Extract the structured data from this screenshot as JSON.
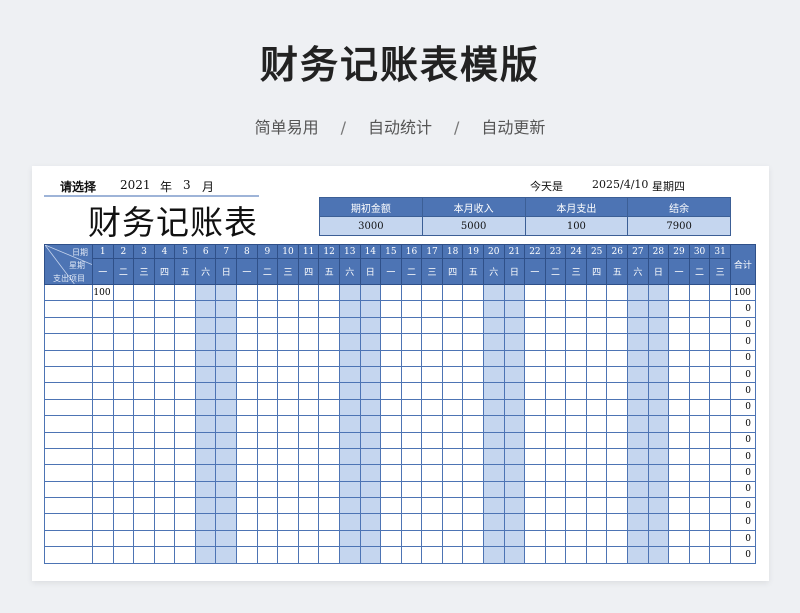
{
  "header": {
    "title": "财务记账表模版",
    "features": [
      "简单易用",
      "自动统计",
      "自动更新"
    ],
    "separator": "/"
  },
  "sheet": {
    "select_label": "请选择",
    "year": "2021",
    "year_unit": "年",
    "month": "3",
    "month_unit": "月",
    "today_label": "今天是",
    "today_date": "2025/4/10",
    "today_weekday": "星期四",
    "big_title": "财务记账表"
  },
  "summary": {
    "headers": [
      "期初金额",
      "本月收入",
      "本月支出",
      "结余"
    ],
    "values": [
      "3000",
      "5000",
      "100",
      "7900"
    ]
  },
  "grid": {
    "corner_date": "日期",
    "corner_week": "星期",
    "corner_item": "支出项目",
    "total_label": "合计",
    "days": [
      "1",
      "2",
      "3",
      "4",
      "5",
      "6",
      "7",
      "8",
      "9",
      "10",
      "11",
      "12",
      "13",
      "14",
      "15",
      "16",
      "17",
      "18",
      "19",
      "20",
      "21",
      "22",
      "23",
      "24",
      "25",
      "26",
      "27",
      "28",
      "29",
      "30",
      "31"
    ],
    "weekdays": [
      "一",
      "二",
      "三",
      "四",
      "五",
      "六",
      "日",
      "一",
      "二",
      "三",
      "四",
      "五",
      "六",
      "日",
      "一",
      "二",
      "三",
      "四",
      "五",
      "六",
      "日",
      "一",
      "二",
      "三",
      "四",
      "五",
      "六",
      "日",
      "一",
      "二",
      "三"
    ],
    "first_entry": "100",
    "row_totals": [
      "100",
      "0",
      "0",
      "0",
      "0",
      "0",
      "0",
      "0",
      "0",
      "0",
      "0",
      "0",
      "0",
      "0",
      "0",
      "0",
      "0"
    ]
  },
  "colors": {
    "header_blue": "#4d74b4",
    "weekend_blue": "#c5d6ef"
  }
}
